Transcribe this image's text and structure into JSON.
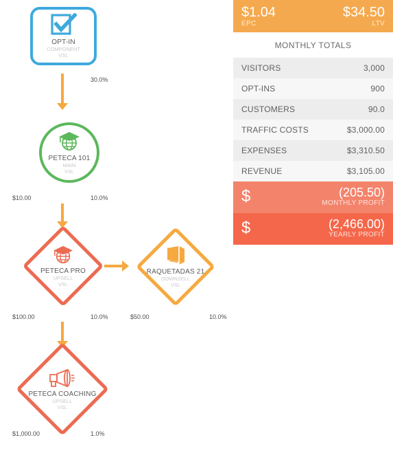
{
  "funnel": {
    "nodes": [
      {
        "id": "opt-in",
        "title": "OPT-IN",
        "sub_line1": "COMPONENT",
        "sub_line2": "VSL",
        "shape": "rounded-square",
        "icon": "checkbox-icon",
        "color": "#3fa9dd"
      },
      {
        "id": "peteca-101",
        "title": "PETECA 101",
        "sub_line1": "MAIN",
        "sub_line2": "VSL",
        "shape": "circle",
        "icon": "globe-graduation-icon",
        "color": "#5cb85c"
      },
      {
        "id": "peteca-pro",
        "title": "PETECA PRO",
        "sub_line1": "UPSELL",
        "sub_line2": "VSL",
        "shape": "diamond",
        "icon": "globe-graduation-icon",
        "color": "#ec6b52"
      },
      {
        "id": "raquetadas-21",
        "title": "RAQUETADAS 21",
        "sub_line1": "DOWNSELL",
        "sub_line2": "VSL",
        "shape": "diamond",
        "icon": "book-icon",
        "color": "#f5a93f"
      },
      {
        "id": "peteca-coaching",
        "title": "PETECA COACHING",
        "sub_line1": "UPSELL",
        "sub_line2": "VSL",
        "shape": "diamond",
        "icon": "megaphone-icon",
        "color": "#ec6b52"
      }
    ],
    "connectors": [
      {
        "id": "optin-to-101",
        "price": "",
        "rate": "30.0%"
      },
      {
        "id": "101-to-pro",
        "price": "$10.00",
        "rate": "10.0%"
      },
      {
        "id": "pro-to-coaching",
        "price": "$100.00",
        "rate": "10.0%"
      },
      {
        "id": "pro-to-raquetadas",
        "price": "$50.00",
        "rate": "10.0%"
      },
      {
        "id": "coaching-out",
        "price": "$1,000.00",
        "rate": "1.0%"
      }
    ]
  },
  "stats": {
    "kpi": {
      "epc_value": "$1.04",
      "epc_label": "EPC",
      "ltv_value": "$34.50",
      "ltv_label": "LTV"
    },
    "totals_header": "MONTHLY TOTALS",
    "rows": [
      {
        "label": "VISITORS",
        "value": "3,000"
      },
      {
        "label": "OPT-INS",
        "value": "900"
      },
      {
        "label": "CUSTOMERS",
        "value": "90.0"
      },
      {
        "label": "TRAFFIC COSTS",
        "value": "$3,000.00"
      },
      {
        "label": "EXPENSES",
        "value": "$3,310.50"
      },
      {
        "label": "REVENUE",
        "value": "$3,105.00"
      }
    ],
    "monthly_profit": {
      "sign": "$",
      "value": "(205.50)",
      "label": "MONTHLY PROFIT"
    },
    "yearly_profit": {
      "sign": "$",
      "value": "(2,466.00)",
      "label": "YEARLY PROFIT"
    }
  },
  "colors": {
    "orange_header": "#f5a94e",
    "blue": "#3fa9dd",
    "green": "#5cb85c",
    "red": "#ec6b52",
    "amber": "#f5a93f",
    "monthly_profit_bg": "#f4836c",
    "yearly_profit_bg": "#f4674b"
  }
}
